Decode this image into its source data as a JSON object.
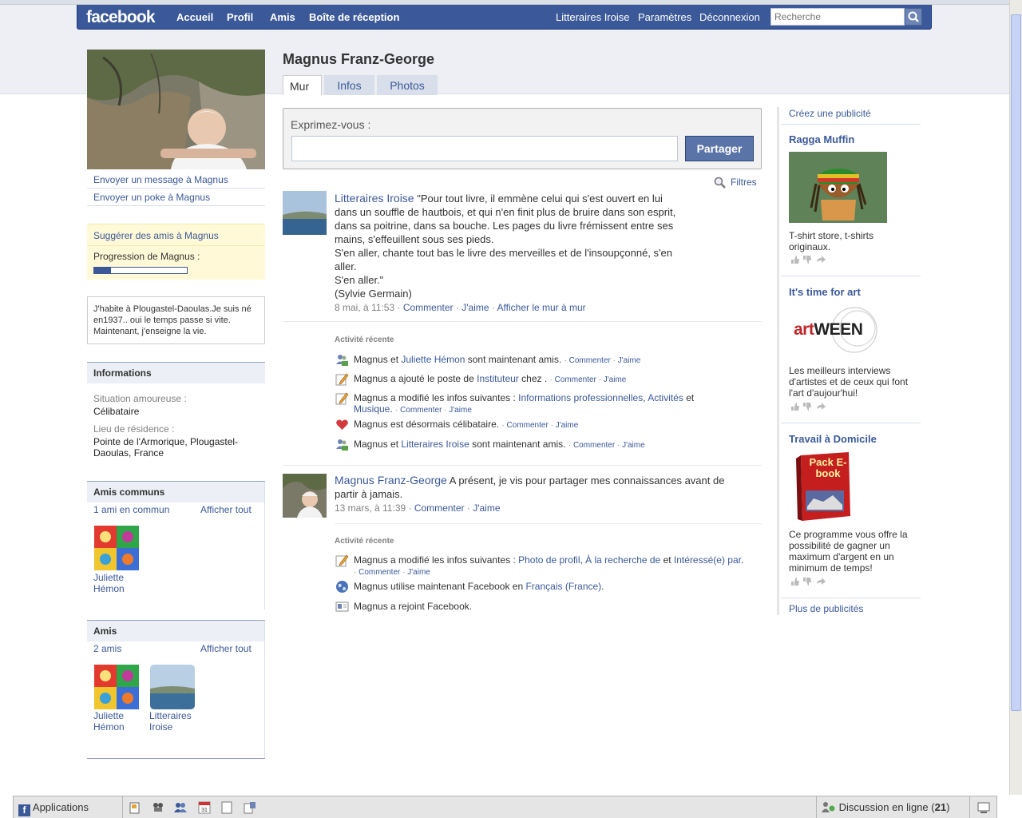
{
  "header": {
    "logo": "facebook",
    "nav": [
      "Accueil",
      "Profil",
      "Amis",
      "Boîte de réception"
    ],
    "nav_right": [
      "Litteraires Iroise",
      "Paramètres",
      "Déconnexion"
    ],
    "search_placeholder": "Recherche"
  },
  "profile": {
    "name": "Magnus Franz-George",
    "tabs": [
      "Mur",
      "Infos",
      "Photos"
    ],
    "active_tab": "Mur"
  },
  "left": {
    "send_message": "Envoyer un message à Magnus",
    "send_poke": "Envoyer un poke à Magnus",
    "suggest_friends": "Suggérer des amis à Magnus",
    "progress_label": "Progression de Magnus :",
    "progress_fraction": 0.18,
    "bio": "J'habite à Plougastel-Daoulas.Je suis né en1937.. oui le temps passe si vite. Maintenant, j'enseigne la vie.",
    "info_title": "Informations",
    "info": [
      {
        "label": "Situation amoureuse :",
        "value": "Célibataire"
      },
      {
        "label": "Lieu de résidence :",
        "value": "Pointe de l'Armorique, Plougastel-Daoulas, France"
      }
    ],
    "mutual": {
      "title": "Amis communs",
      "count": "1 ami en commun",
      "see_all": "Afficher tout",
      "friends": [
        "Juliette Hémon"
      ]
    },
    "friends": {
      "title": "Amis",
      "count": "2 amis",
      "see_all": "Afficher tout",
      "list": [
        "Juliette Hémon",
        "Litteraires Iroise"
      ]
    }
  },
  "publisher": {
    "label": "Exprimez-vous :",
    "value": "",
    "share": "Partager"
  },
  "filters": "Filtres",
  "stories": [
    {
      "author": "Litteraires Iroise",
      "text_first": "\"Pour tout livre, il emmène celui qui s'est ouvert en lui",
      "text_lines": [
        "dans un souffle de hautbois, et qui n'en finit plus de bruire dans son esprit,",
        "dans sa poitrine, dans sa bouche. Les pages du livre frémissent entre ses",
        "mains, s'effeuillent sous ses pieds.",
        "S'en aller, chante tout bas le livre des merveilles et de l'insoupçonné, s'en",
        "aller.",
        "S'en aller.\"",
        "(Sylvie Germain)"
      ],
      "time": "8 mai, à 11:53",
      "actions": [
        "Commenter",
        "J'aime",
        "Afficher le mur à mur"
      ]
    },
    {
      "author": "Magnus Franz-George",
      "text_first": "A présent, je vis pour partager mes connaissances avant de",
      "text_lines": [
        "partir à jamais."
      ],
      "time": "13 mars, à 11:39",
      "actions": [
        "Commenter",
        "J'aime"
      ]
    }
  ],
  "activity1": {
    "title": "Activité récente",
    "items": [
      {
        "icon": "friends-icon",
        "pre": "Magnus et ",
        "link": "Juliette Hémon",
        "post": " sont maintenant amis."
      },
      {
        "icon": "pencil-icon",
        "pre": "Magnus a ajouté le poste de ",
        "link": "Instituteur",
        "post": " chez ."
      },
      {
        "icon": "pencil-icon",
        "pre": "Magnus a modifié les infos suivantes : ",
        "link": "Informations professionnelles",
        "sep": ", ",
        "link2": "Activités",
        "sep2": " et ",
        "link3": "Musique",
        "post": "."
      },
      {
        "icon": "heart-icon",
        "pre": "Magnus est désormais célibataire.",
        "link": "",
        "post": ""
      },
      {
        "icon": "friends-icon",
        "pre": "Magnus et ",
        "link": "Litteraires Iroise",
        "post": " sont maintenant amis."
      }
    ],
    "comment": "Commenter",
    "like": "J'aime"
  },
  "activity2": {
    "title": "Activité récente",
    "items": [
      {
        "icon": "pencil-icon",
        "pre": "Magnus a modifié les infos suivantes : ",
        "link": "Photo de profil",
        "sep": ", ",
        "link2": "À la recherche de",
        "sep2": " et ",
        "link3": "Intéressé(e)",
        "line2_link": "par",
        "post": "."
      },
      {
        "icon": "globe-icon",
        "pre": "Magnus utilise maintenant Facebook en ",
        "link": "Français (France)",
        "post": "."
      },
      {
        "icon": "card-icon",
        "pre": "Magnus a rejoint Facebook.",
        "link": "",
        "post": ""
      }
    ]
  },
  "ads": {
    "create": "Créez une publicité",
    "items": [
      {
        "title": "Ragga Muffin",
        "text": "T-shirt store, t-shirts originaux."
      },
      {
        "title": "It's time for art",
        "image_text": "artWEEN",
        "text": "Les meilleurs interviews d'artistes et de ceux qui font l'art d'aujour'hui!"
      },
      {
        "title": "Travail à Domicile",
        "image_text": "Pack E-book",
        "text": "Ce programme vous offre la possibilité de gagner un maximum d'argent en un minimum de temps!"
      }
    ],
    "more": "Plus de publicités"
  },
  "chatbar": {
    "applications": "Applications",
    "online_label": "Discussion en ligne",
    "online_count": "21"
  }
}
